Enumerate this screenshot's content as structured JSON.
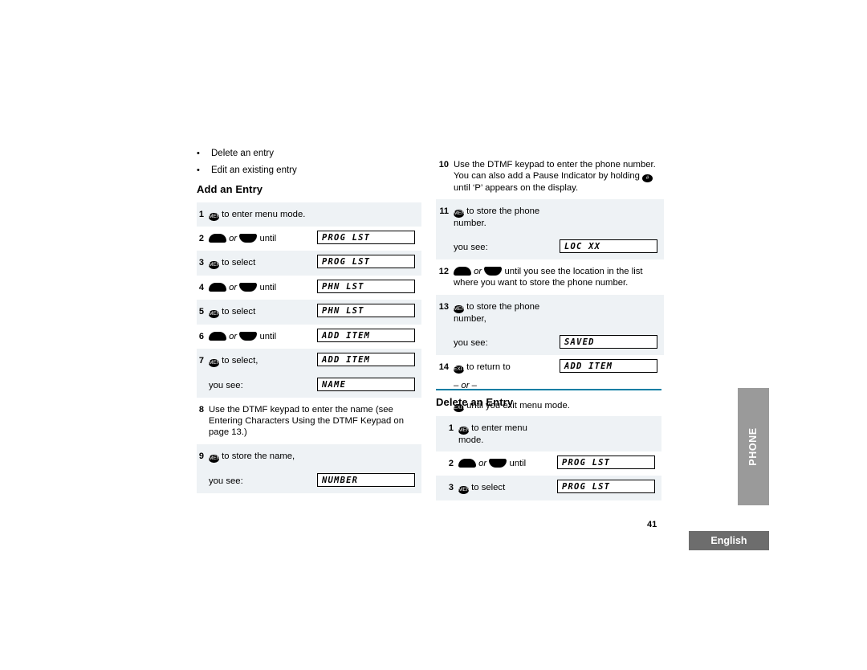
{
  "page": {
    "number": "41",
    "language_tab": "English",
    "side_tab": "PHONE"
  },
  "bullets": [
    "Delete an entry",
    "Edit an existing entry"
  ],
  "headings": {
    "add_an_entry": "Add an Entry",
    "delete_an_entry": "Delete an Entry"
  },
  "labels": {
    "you_see": "you see:",
    "or": "or",
    "until": "until",
    "or_dash": "– or –"
  },
  "icons": {
    "menu_key": "menu-key-icon",
    "up_key": "up-arrow-key-icon",
    "down_key": "down-arrow-key-icon",
    "pound_key": "pound-key-icon",
    "exit_key": "exit-key-icon"
  },
  "add_entry_steps": [
    {
      "num": "1",
      "text": "to enter menu mode.",
      "lcd": ""
    },
    {
      "num": "2",
      "text": "until",
      "lcd": "PROG LST"
    },
    {
      "num": "3",
      "text": "to select",
      "lcd": "PROG LST"
    },
    {
      "num": "4",
      "text": "until",
      "lcd": "PHN LST"
    },
    {
      "num": "5",
      "text": "to select",
      "lcd": "PHN LST"
    },
    {
      "num": "6",
      "text": "until",
      "lcd": "ADD ITEM"
    },
    {
      "num": "7",
      "text": "to select,",
      "lcd": "ADD ITEM"
    },
    {
      "num": "7b",
      "text": "you see:",
      "lcd": "NAME"
    },
    {
      "num": "8",
      "text": "Use the DTMF keypad to enter the name (see Entering Characters Using the DTMF Keypad on page 13.)",
      "lcd": ""
    },
    {
      "num": "9",
      "text": "to store the name,",
      "lcd": ""
    },
    {
      "num": "9b",
      "text": "you see:",
      "lcd": "NUMBER"
    }
  ],
  "add_entry_steps_right": [
    {
      "num": "10",
      "text_before": "Use the DTMF keypad to enter the phone number. You can also add a Pause Indicator by holding",
      "text_after": "until ‘P’ appears on the display.",
      "lcd": ""
    },
    {
      "num": "11",
      "text": "to store the phone number.",
      "lcd": ""
    },
    {
      "num": "11b",
      "text": "you see:",
      "lcd": "LOC XX"
    },
    {
      "num": "12",
      "text": "until you see the location in the list where you want to store the phone number.",
      "lcd": ""
    },
    {
      "num": "13",
      "text": "to store the phone number,",
      "lcd": ""
    },
    {
      "num": "13b",
      "text": "you see:",
      "lcd": "SAVED"
    },
    {
      "num": "14",
      "text": "to return to",
      "lcd": "ADD ITEM"
    },
    {
      "num": "14b",
      "text": "until you exit menu mode.",
      "lcd": ""
    }
  ],
  "delete_entry_steps": [
    {
      "num": "1",
      "text": "to enter menu mode.",
      "lcd": ""
    },
    {
      "num": "2",
      "text": "until",
      "lcd": "PROG LST"
    },
    {
      "num": "3",
      "text": "to select",
      "lcd": "PROG LST"
    }
  ],
  "colors": {
    "rule": "#0a7ea4",
    "shade": "#eef2f5",
    "tab_gray": "#9a9a9a",
    "english_gray": "#6d6d6d"
  }
}
